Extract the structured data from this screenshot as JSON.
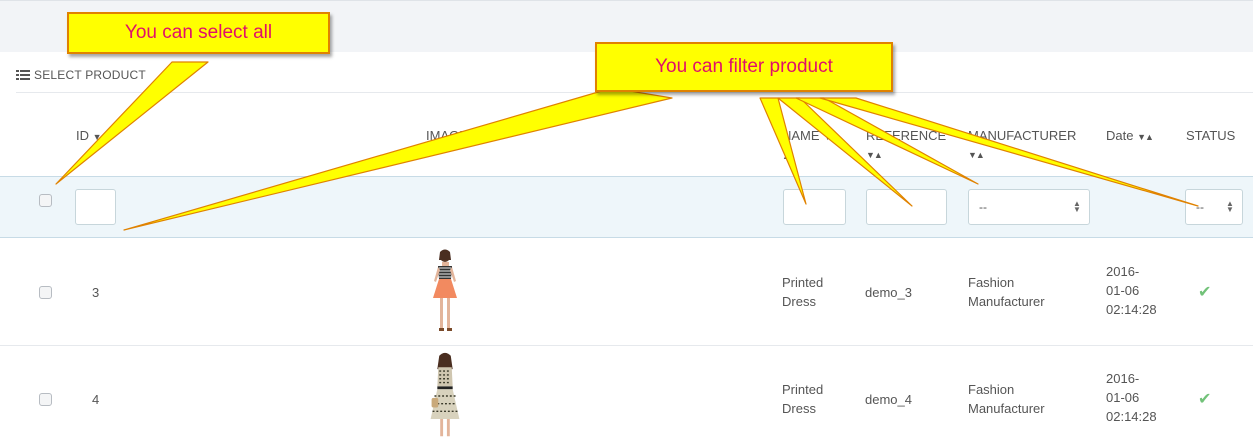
{
  "panel": {
    "title": "SELECT PRODUCT"
  },
  "columns": {
    "id": "ID",
    "image": "IMAGE",
    "name": "NAME",
    "reference": "REFERENCE",
    "manufacturer": "MANUFACTURER",
    "date": "Date",
    "status": "STATUS"
  },
  "filters": {
    "manufacturer_value": "--",
    "status_value": "--"
  },
  "rows": [
    {
      "id": "3",
      "name": "Printed Dress",
      "reference": "demo_3",
      "manufacturer": "Fashion Manufacturer",
      "date_1": "2016-",
      "date_2": "01-06",
      "date_3": "02:14:28",
      "status": "✔"
    },
    {
      "id": "4",
      "name": "Printed Dress",
      "reference": "demo_4",
      "manufacturer": "Fashion Manufacturer",
      "date_1": "2016-",
      "date_2": "01-06",
      "date_3": "02:14:28",
      "status": "✔"
    }
  ],
  "annotations": {
    "select_all": "You can select all",
    "filter_product": "You can filter product"
  },
  "icons": {
    "list": "list-icon",
    "sort": "sort-icon",
    "status_enabled": "check-icon",
    "select_arrows": "select-arrows-icon"
  },
  "colors": {
    "callout_bg": "#ffff00",
    "callout_text": "#e0106a",
    "callout_border": "#e08200",
    "filter_row_bg": "#eef6fa",
    "status_check": "#72c279"
  }
}
